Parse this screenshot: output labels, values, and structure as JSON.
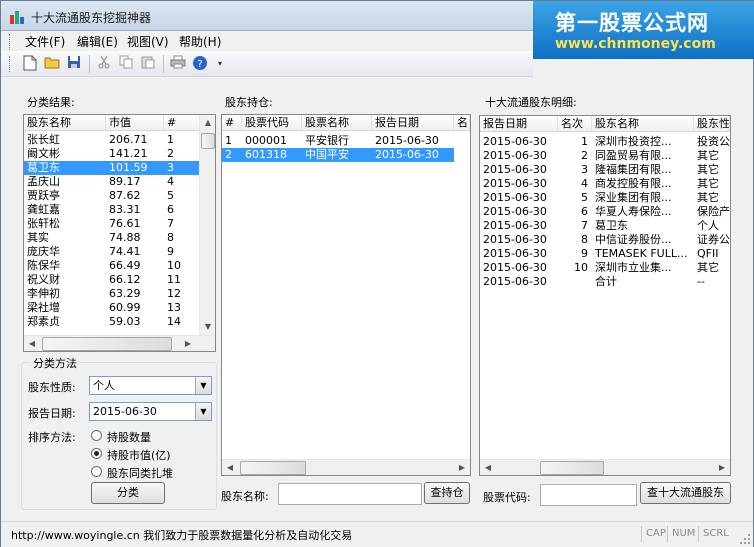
{
  "window": {
    "title": "十大流通股东挖掘神器"
  },
  "watermark": {
    "title": "第一股票公式网",
    "url": "www.chnmoney.com"
  },
  "menu": [
    "文件(F)",
    "编辑(E)",
    "视图(V)",
    "帮助(H)"
  ],
  "toolbar_icons": [
    "new-file-icon",
    "open-folder-icon",
    "save-icon",
    "cut-icon",
    "copy-icon",
    "paste-icon",
    "print-icon",
    "help-icon"
  ],
  "left": {
    "section_label": "分类结果:",
    "columns": [
      "股东名称",
      "市值",
      "#"
    ],
    "rows": [
      [
        "张长虹",
        "206.71",
        "1"
      ],
      [
        "阚文彬",
        "141.21",
        "2"
      ],
      [
        "葛卫东",
        "101.59",
        "3"
      ],
      [
        "孟庆山",
        "89.17",
        "4"
      ],
      [
        "贾跃亭",
        "87.62",
        "5"
      ],
      [
        "龚虹嘉",
        "83.31",
        "6"
      ],
      [
        "张轩松",
        "76.61",
        "7"
      ],
      [
        "其实",
        "74.88",
        "8"
      ],
      [
        "庞庆华",
        "74.41",
        "9"
      ],
      [
        "陈保华",
        "66.49",
        "10"
      ],
      [
        "祝义财",
        "66.12",
        "11"
      ],
      [
        "李伸初",
        "63.29",
        "12"
      ],
      [
        "梁社增",
        "60.99",
        "13"
      ],
      [
        "郑素贞",
        "59.03",
        "14"
      ]
    ],
    "selected_row": 2
  },
  "method": {
    "group_title": "分类方法",
    "nature_label": "股东性质:",
    "nature_value": "个人",
    "date_label": "报告日期:",
    "date_value": "2015-06-30",
    "sort_label": "排序方法:",
    "options": [
      "持股数量",
      "持股市值(亿)",
      "股东同类扎堆"
    ],
    "selected_option": 1,
    "classify_button": "分类"
  },
  "middle": {
    "section_label": "股东持仓:",
    "columns": [
      "#",
      "股票代码",
      "股票名称",
      "报告日期",
      "名"
    ],
    "rows": [
      [
        "1",
        "000001",
        "平安银行",
        "2015-06-30"
      ],
      [
        "2",
        "601318",
        "中国平安",
        "2015-06-30"
      ]
    ],
    "selected_row": 1,
    "search_label": "股东名称:",
    "search_value": "",
    "search_button": "查持仓"
  },
  "right": {
    "section_label": "十大流通股东明细:",
    "columns": [
      "报告日期",
      "名次",
      "股东名称",
      "股东性"
    ],
    "rows": [
      [
        "2015-06-30",
        "1",
        "深圳市投资控...",
        "投资公"
      ],
      [
        "2015-06-30",
        "2",
        "同盈贸易有限...",
        "其它"
      ],
      [
        "2015-06-30",
        "3",
        "隆福集团有限...",
        "其它"
      ],
      [
        "2015-06-30",
        "4",
        "商发控股有限...",
        "其它"
      ],
      [
        "2015-06-30",
        "5",
        "深业集团有限...",
        "其它"
      ],
      [
        "2015-06-30",
        "6",
        "华夏人寿保险...",
        "保险产"
      ],
      [
        "2015-06-30",
        "7",
        "葛卫东",
        "个人"
      ],
      [
        "2015-06-30",
        "8",
        "中信证券股份...",
        "证券公"
      ],
      [
        "2015-06-30",
        "9",
        "TEMASEK FULL...",
        "QFII"
      ],
      [
        "2015-06-30",
        "10",
        "深圳市立业集...",
        "其它"
      ],
      [
        "2015-06-30",
        "",
        "合计",
        "--"
      ]
    ],
    "code_label": "股票代码:",
    "code_value": "",
    "query_button": "查十大流通股东"
  },
  "status": {
    "text": "http://www.woyingle.cn 我们致力于股票数据量化分析及自动化交易",
    "indicators": [
      "CAP",
      "NUM",
      "SCRL"
    ]
  }
}
